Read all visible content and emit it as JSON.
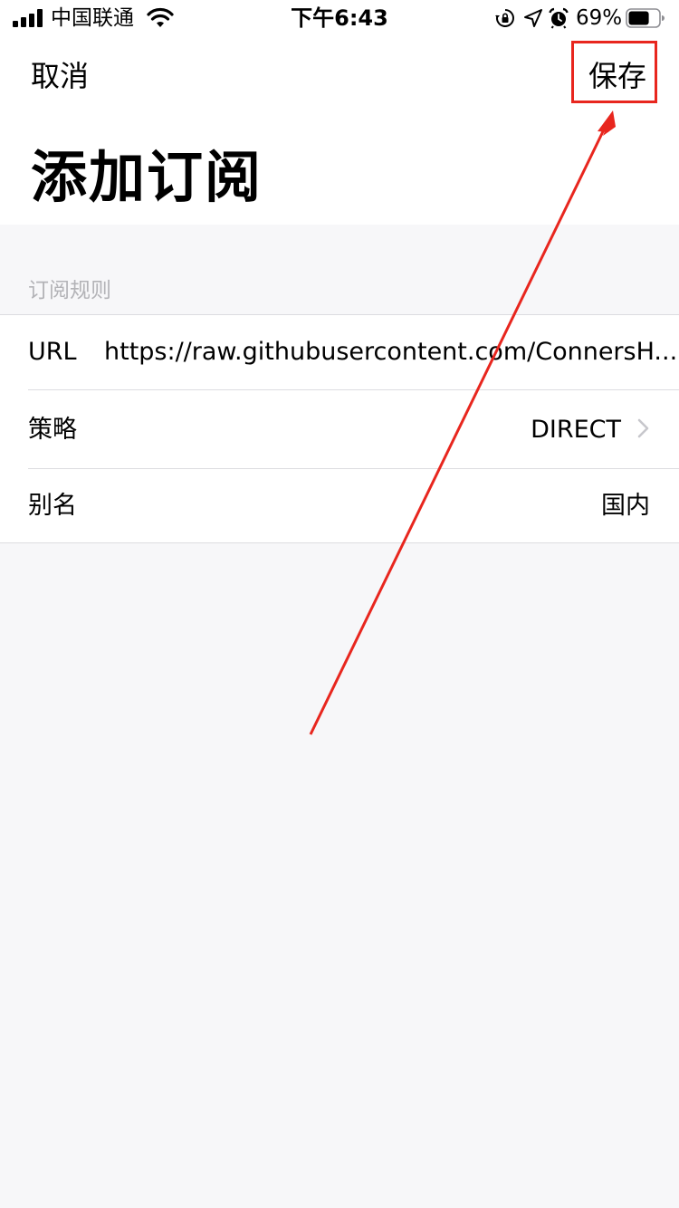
{
  "status_bar": {
    "carrier": "中国联通",
    "time": "下午6:43",
    "battery_percent": "69%",
    "battery_level": 0.69,
    "icons": [
      "signal-icon",
      "wifi-icon",
      "orientation-lock-icon",
      "location-icon",
      "alarm-icon",
      "battery-icon"
    ]
  },
  "nav": {
    "cancel_label": "取消",
    "save_label": "保存"
  },
  "page": {
    "title": "添加订阅"
  },
  "section": {
    "header": "订阅规则",
    "rows": [
      {
        "label": "URL",
        "value": "https://raw.githubusercontent.com/ConnersH..."
      },
      {
        "label": "策略",
        "value": "DIRECT"
      },
      {
        "label": "别名",
        "value": "国内"
      }
    ]
  },
  "annotation": {
    "color": "#e8261e"
  },
  "colors": {
    "background": "#f7f7f9",
    "card": "#ffffff",
    "section_header": "#b3b3b7",
    "separator": "#dcdce0"
  }
}
